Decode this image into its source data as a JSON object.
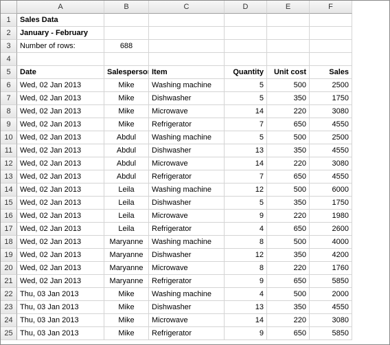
{
  "columns": [
    "A",
    "B",
    "C",
    "D",
    "E",
    "F"
  ],
  "title_rows": {
    "title": "Sales Data",
    "subtitle": "January - February",
    "num_rows_label": "Number of rows:",
    "num_rows_value": "688"
  },
  "headers": {
    "date": "Date",
    "salesperson": "Salesperson",
    "item": "Item",
    "quantity": "Quantity",
    "unitcost": "Unit cost",
    "sales": "Sales"
  },
  "rows": [
    {
      "date": "Wed, 02 Jan 2013",
      "sp": "Mike",
      "item": "Washing machine",
      "qty": 5,
      "uc": 500,
      "sales": 2500
    },
    {
      "date": "Wed, 02 Jan 2013",
      "sp": "Mike",
      "item": "Dishwasher",
      "qty": 5,
      "uc": 350,
      "sales": 1750
    },
    {
      "date": "Wed, 02 Jan 2013",
      "sp": "Mike",
      "item": "Microwave",
      "qty": 14,
      "uc": 220,
      "sales": 3080
    },
    {
      "date": "Wed, 02 Jan 2013",
      "sp": "Mike",
      "item": "Refrigerator",
      "qty": 7,
      "uc": 650,
      "sales": 4550
    },
    {
      "date": "Wed, 02 Jan 2013",
      "sp": "Abdul",
      "item": "Washing machine",
      "qty": 5,
      "uc": 500,
      "sales": 2500
    },
    {
      "date": "Wed, 02 Jan 2013",
      "sp": "Abdul",
      "item": "Dishwasher",
      "qty": 13,
      "uc": 350,
      "sales": 4550
    },
    {
      "date": "Wed, 02 Jan 2013",
      "sp": "Abdul",
      "item": "Microwave",
      "qty": 14,
      "uc": 220,
      "sales": 3080
    },
    {
      "date": "Wed, 02 Jan 2013",
      "sp": "Abdul",
      "item": "Refrigerator",
      "qty": 7,
      "uc": 650,
      "sales": 4550
    },
    {
      "date": "Wed, 02 Jan 2013",
      "sp": "Leila",
      "item": "Washing machine",
      "qty": 12,
      "uc": 500,
      "sales": 6000
    },
    {
      "date": "Wed, 02 Jan 2013",
      "sp": "Leila",
      "item": "Dishwasher",
      "qty": 5,
      "uc": 350,
      "sales": 1750
    },
    {
      "date": "Wed, 02 Jan 2013",
      "sp": "Leila",
      "item": "Microwave",
      "qty": 9,
      "uc": 220,
      "sales": 1980
    },
    {
      "date": "Wed, 02 Jan 2013",
      "sp": "Leila",
      "item": "Refrigerator",
      "qty": 4,
      "uc": 650,
      "sales": 2600
    },
    {
      "date": "Wed, 02 Jan 2013",
      "sp": "Maryanne",
      "item": "Washing machine",
      "qty": 8,
      "uc": 500,
      "sales": 4000
    },
    {
      "date": "Wed, 02 Jan 2013",
      "sp": "Maryanne",
      "item": "Dishwasher",
      "qty": 12,
      "uc": 350,
      "sales": 4200
    },
    {
      "date": "Wed, 02 Jan 2013",
      "sp": "Maryanne",
      "item": "Microwave",
      "qty": 8,
      "uc": 220,
      "sales": 1760
    },
    {
      "date": "Wed, 02 Jan 2013",
      "sp": "Maryanne",
      "item": "Refrigerator",
      "qty": 9,
      "uc": 650,
      "sales": 5850
    },
    {
      "date": "Thu, 03 Jan 2013",
      "sp": "Mike",
      "item": "Washing machine",
      "qty": 4,
      "uc": 500,
      "sales": 2000
    },
    {
      "date": "Thu, 03 Jan 2013",
      "sp": "Mike",
      "item": "Dishwasher",
      "qty": 13,
      "uc": 350,
      "sales": 4550
    },
    {
      "date": "Thu, 03 Jan 2013",
      "sp": "Mike",
      "item": "Microwave",
      "qty": 14,
      "uc": 220,
      "sales": 3080
    },
    {
      "date": "Thu, 03 Jan 2013",
      "sp": "Mike",
      "item": "Refrigerator",
      "qty": 9,
      "uc": 650,
      "sales": 5850
    }
  ]
}
